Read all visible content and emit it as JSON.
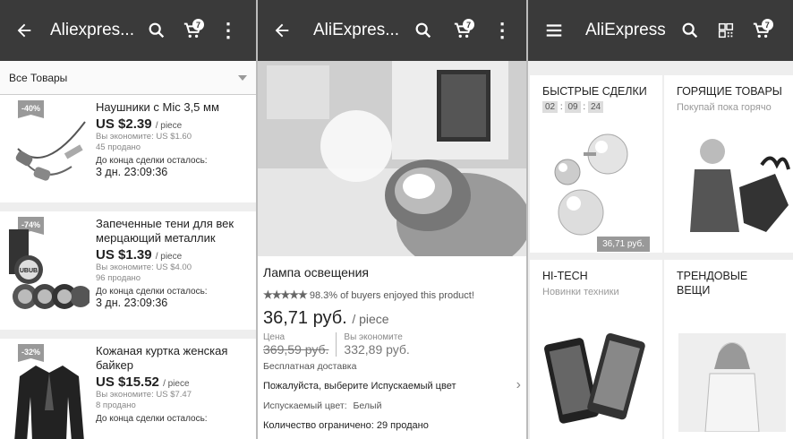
{
  "screen1": {
    "title": "Aliexpres...",
    "cart_count": "7",
    "filter_label": "Все Товары",
    "items": [
      {
        "discount": "-40%",
        "name": "Наушники с Mic 3,5 мм",
        "price": "US $2.39",
        "unit": "/ piece",
        "savings": "Вы экономите: US $1.60",
        "sold": "45 продано",
        "ends_label": "До конца сделки осталось:",
        "time_left": "3 дн. 23:09:36"
      },
      {
        "discount": "-74%",
        "name": "Запеченные тени для век мерцающий металлик",
        "price": "US $1.39",
        "unit": "/ piece",
        "savings": "Вы экономите: US $4.00",
        "sold": "96 продано",
        "ends_label": "До конца сделки осталось:",
        "time_left": "3 дн. 23:09:36"
      },
      {
        "discount": "-32%",
        "name": "Кожаная куртка женская байкер",
        "price": "US $15.52",
        "unit": "/ piece",
        "savings": "Вы экономите: US $7.47",
        "sold": "8 продано",
        "ends_label": "До конца сделки осталось:",
        "time_left": ""
      }
    ],
    "brand_text": "UBUB"
  },
  "screen2": {
    "title": "AliExpres...",
    "cart_count": "7",
    "product_name": "Лампа освещения",
    "stars": "★★★★★",
    "rating_text": "98.3% of buyers enjoyed this product!",
    "price": "36,71 руб.",
    "unit": "/ piece",
    "price_label": "Цена",
    "old_price": "369,59 руб.",
    "save_label": "Вы экономите",
    "save_value": "332,89 руб.",
    "shipping": "Бесплатная доставка",
    "choose_color": "Пожалуйста, выберите Испускаемый цвет",
    "color_label": "Испускаемый цвет:",
    "color_value": "Белый",
    "limited": "Количество ограничено: 29 продано"
  },
  "screen3": {
    "title": "AliExpress",
    "cart_count": "7",
    "tiles": [
      {
        "title": "БЫСТРЫЕ СДЕЛКИ",
        "timer": [
          "02",
          "09",
          "24"
        ],
        "price": "36,71 руб."
      },
      {
        "title": "ГОРЯЩИЕ ТОВАРЫ",
        "subtitle": "Покупай пока горячо"
      },
      {
        "title": "HI-TECH",
        "subtitle": "Новинки техники"
      },
      {
        "title": "ТРЕНДОВЫЕ ВЕЩИ"
      }
    ]
  }
}
